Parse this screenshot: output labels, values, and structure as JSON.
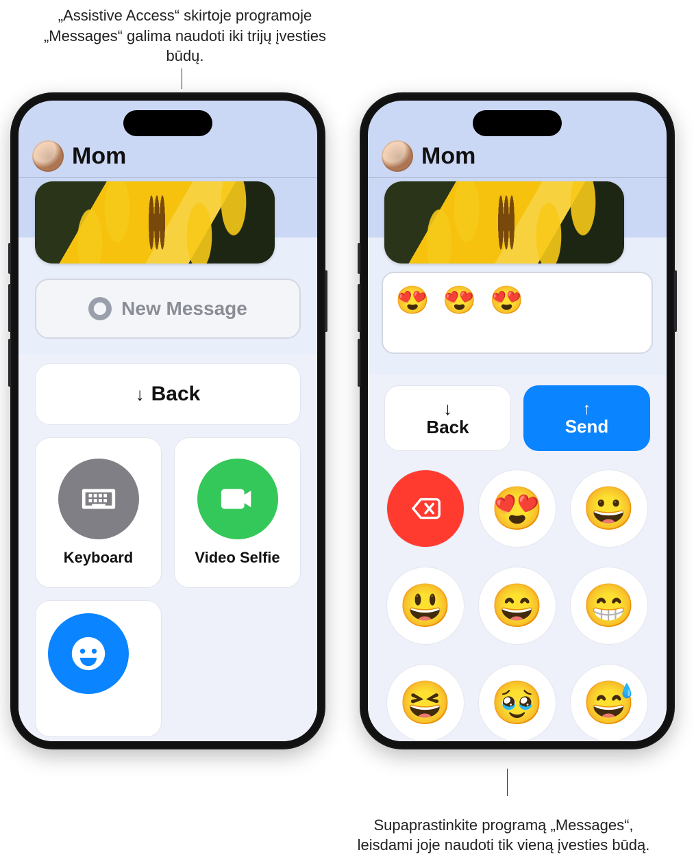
{
  "callouts": {
    "top": "„Assistive Access“ skirtoje programoje „Messages“ galima naudoti iki trijų įvesties būdų.",
    "bottom": "Supaprastinkite programą „Messages“, leisdami joje naudoti tik vieną įvesties būdą."
  },
  "phoneA": {
    "contact_name": "Mom",
    "new_message_placeholder": "New Message",
    "back_label": "Back",
    "tiles": {
      "keyboard": "Keyboard",
      "video_selfie": "Video Selfie"
    },
    "icons": {
      "keyboard": "keyboard-icon",
      "video_selfie": "video-icon",
      "emoji": "smiley-icon"
    }
  },
  "phoneB": {
    "contact_name": "Mom",
    "compose_value": "😍 😍 😍",
    "back_label": "Back",
    "send_label": "Send",
    "emoji_keyboard": {
      "delete_icon": "delete-icon",
      "emojis": [
        "😍",
        "😀",
        "😃",
        "😄",
        "😁",
        "😆",
        "🥹",
        "😅"
      ]
    }
  }
}
